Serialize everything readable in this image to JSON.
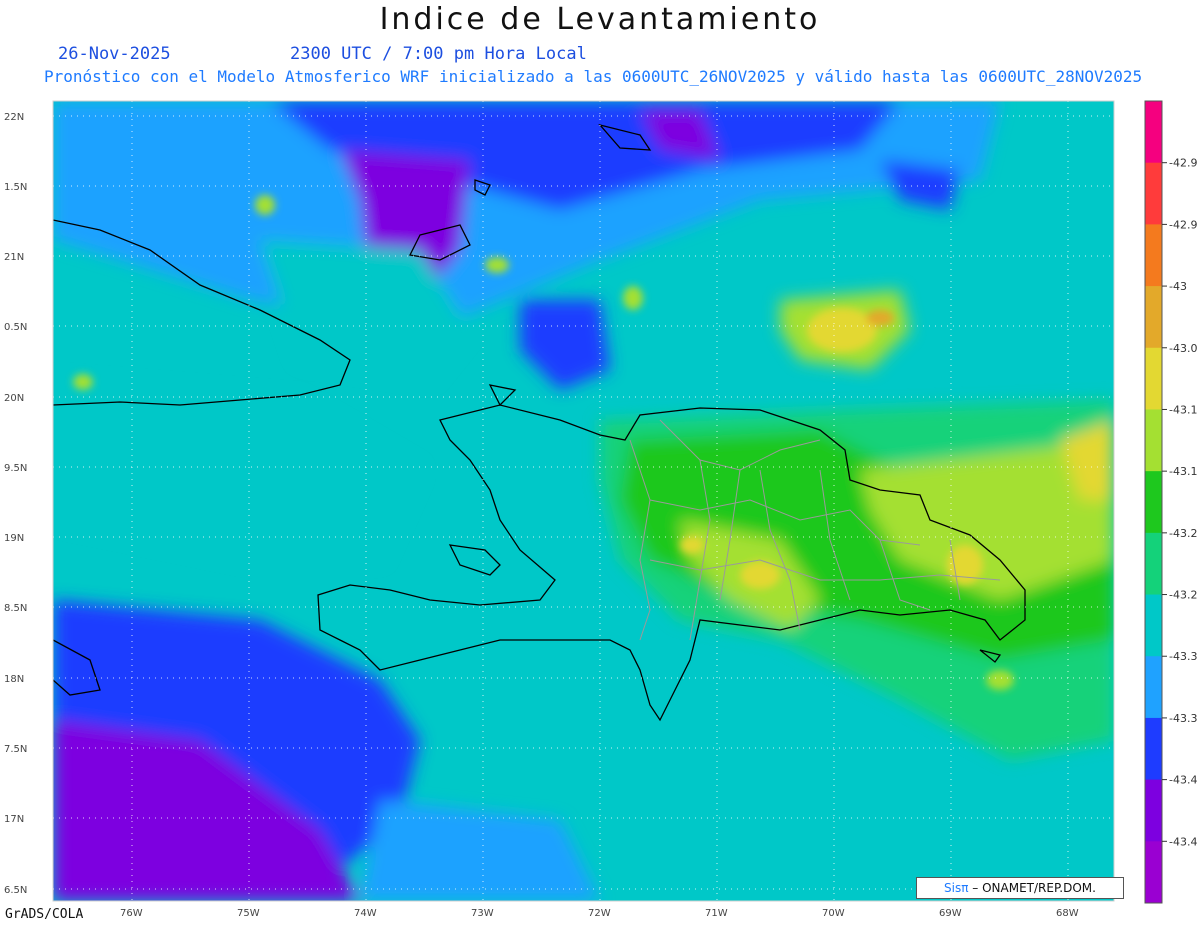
{
  "header": {
    "title": "Indice de Levantamiento",
    "date": "26-Nov-2025",
    "time": "2300 UTC / 7:00 pm Hora Local",
    "subtitle": "Pronóstico con el Modelo Atmosferico WRF inicializado a las 0600UTC_26NOV2025 y válido hasta las  0600UTC_28NOV2025"
  },
  "axes": {
    "lat_labels": [
      "22N",
      "1.5N",
      "21N",
      "0.5N",
      "20N",
      "9.5N",
      "19N",
      "8.5N",
      "18N",
      "7.5N",
      "17N",
      "6.5N"
    ],
    "lon_labels": [
      "76W",
      "75W",
      "74W",
      "73W",
      "72W",
      "71W",
      "70W",
      "69W",
      "68W"
    ]
  },
  "colorbar": {
    "colors": [
      "#f5007f",
      "#ff3b3b",
      "#f47a1e",
      "#e3a92a",
      "#e3d832",
      "#a4e032",
      "#1ec81e",
      "#14d27a",
      "#00c8c8",
      "#1fa2ff",
      "#1e3cff",
      "#7d00e0",
      "#9a00d2"
    ],
    "labels": [
      "-42.9",
      "-42.9",
      "-43",
      "-43.0",
      "-43.1",
      "-43.1",
      "-43.2",
      "-43.2",
      "-43.3",
      "-43.3",
      "-43.4",
      "-43.4"
    ]
  },
  "footer": {
    "credit": "GrADS/COLA",
    "logo_brand": "Sisπ",
    "logo_org": " – ONAMET/REP.DOM."
  }
}
